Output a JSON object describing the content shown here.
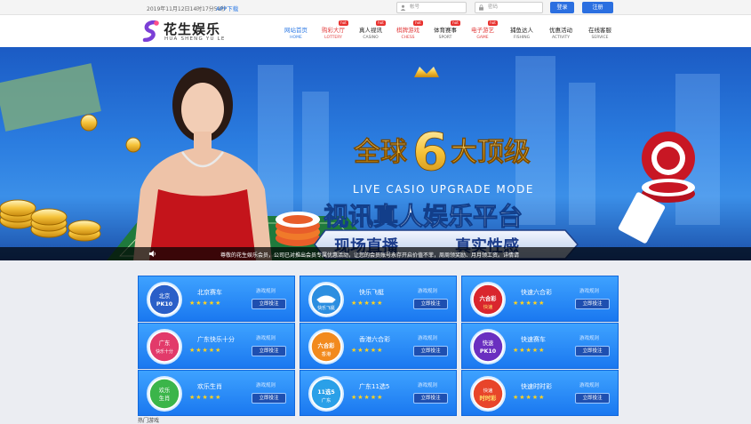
{
  "topbar": {
    "datetime": "2019年11月12日14时17分58秒",
    "app_download": "APP下载",
    "username_placeholder": "帐号",
    "password_placeholder": "密码",
    "login_label": "登录",
    "register_label": "注册"
  },
  "header": {
    "logo_cn": "花生娱乐",
    "logo_en": "HUA SHENG YU LE",
    "nav": [
      {
        "cn": "网站首页",
        "en": "HOME",
        "hot": ""
      },
      {
        "cn": "购彩大厅",
        "en": "LOTTERY",
        "hot": "hot"
      },
      {
        "cn": "真人视讯",
        "en": "CASINO",
        "hot": "hot"
      },
      {
        "cn": "棋牌游戏",
        "en": "CHESS",
        "hot": "hot"
      },
      {
        "cn": "体育赛事",
        "en": "SPORT",
        "hot": "hot"
      },
      {
        "cn": "电子游艺",
        "en": "GAME",
        "hot": "hot"
      },
      {
        "cn": "捕鱼达人",
        "en": "FISHING",
        "hot": ""
      },
      {
        "cn": "优惠活动",
        "en": "ACTIVITY",
        "hot": ""
      },
      {
        "cn": "在线客服",
        "en": "SERVICE",
        "hot": ""
      }
    ]
  },
  "banner": {
    "headline_a": "全球",
    "headline_num": "6",
    "headline_b": "大顶级",
    "subtitle_en": "LIVE CASIO UPGRADE MODE",
    "title2": "视讯真人娱乐平台",
    "ribbon_a": "现场直播",
    "ribbon_b": "真实性感",
    "ticker": "尊敬的花生娱乐会员，公司已对推出会员专属优惠活动，让您的会员账号永存开启价值不菲，周周领奖励、月月领工资。详情请"
  },
  "games": {
    "cards": [
      {
        "name": "北京赛车",
        "rule": "游戏规则",
        "bet": "立即投注",
        "stars": "★★★★★",
        "icon_text": "北京",
        "icon_sub": "PK10"
      },
      {
        "name": "快乐飞艇",
        "rule": "游戏规则",
        "bet": "立即投注",
        "stars": "★★★★★",
        "icon_text": "快乐飞艇",
        "icon_sub": ""
      },
      {
        "name": "快速六合彩",
        "rule": "游戏规则",
        "bet": "立即投注",
        "stars": "★★★★★",
        "icon_text": "六合彩",
        "icon_sub": "快速"
      },
      {
        "name": "广东快乐十分",
        "rule": "游戏规则",
        "bet": "立即投注",
        "stars": "★★★★★",
        "icon_text": "广东",
        "icon_sub": "快乐十分"
      },
      {
        "name": "香港六合彩",
        "rule": "游戏规则",
        "bet": "立即投注",
        "stars": "★★★★★",
        "icon_text": "六合彩",
        "icon_sub": "香港"
      },
      {
        "name": "快速赛车",
        "rule": "游戏规则",
        "bet": "立即投注",
        "stars": "★★★★★",
        "icon_text": "快速",
        "icon_sub": "PK10"
      },
      {
        "name": "欢乐生肖",
        "rule": "游戏规则",
        "bet": "立即投注",
        "stars": "★★★★★",
        "icon_text": "欢乐",
        "icon_sub": "生肖"
      },
      {
        "name": "广东11选5",
        "rule": "游戏规则",
        "bet": "立即投注",
        "stars": "★★★★★",
        "icon_text": "11选5",
        "icon_sub": "广东"
      },
      {
        "name": "快速时时彩",
        "rule": "游戏规则",
        "bet": "立即投注",
        "stars": "★★★★★",
        "icon_text": "时时彩",
        "icon_sub": "快速"
      }
    ],
    "hot_label": "热门游戏"
  }
}
